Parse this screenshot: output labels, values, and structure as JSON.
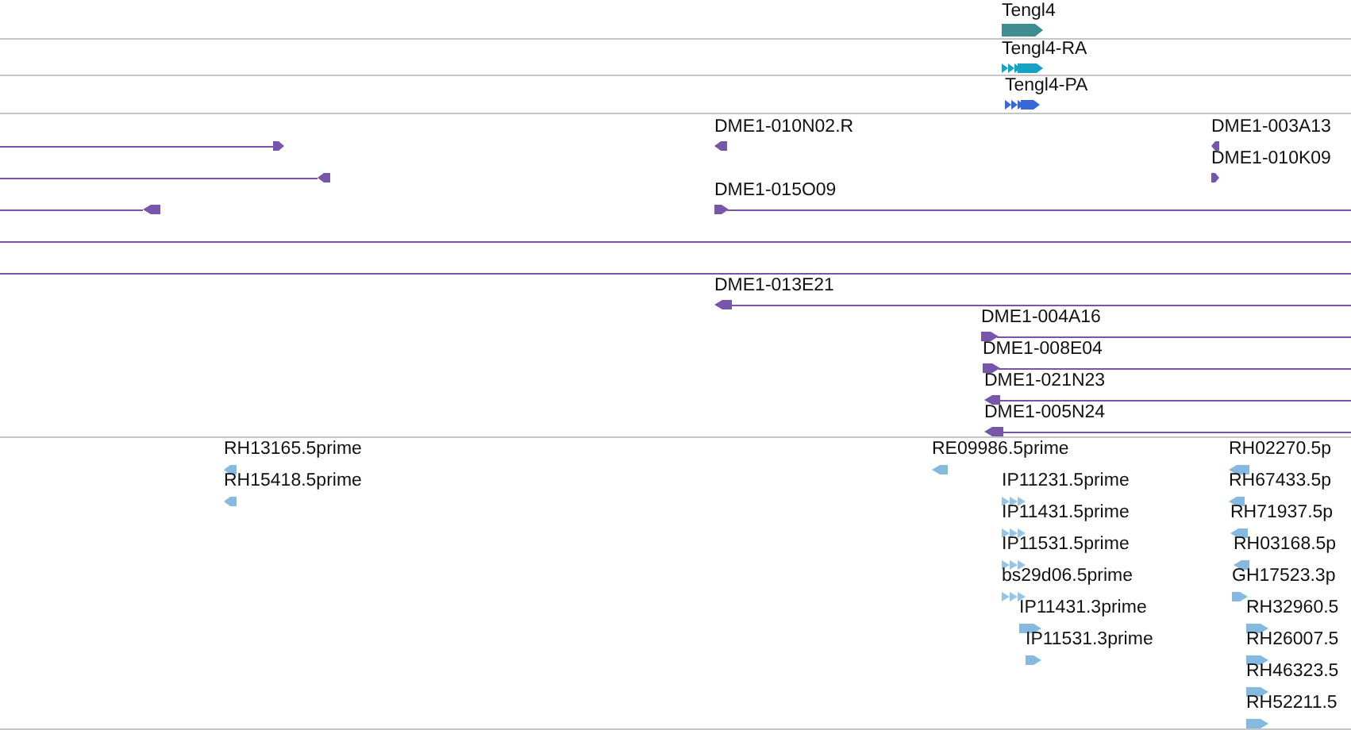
{
  "tracks": [
    {
      "color": "#3f8c91",
      "features": [
        {
          "kind": "gene",
          "label": "Tengl4",
          "reverse": false
        }
      ]
    },
    {
      "color": "#17a2c4",
      "features": [
        {
          "kind": "transcript",
          "label": "Tengl4-RA",
          "reverse": false
        }
      ]
    },
    {
      "color": "#3768d6",
      "features": [
        {
          "kind": "transcript",
          "label": "Tengl4-PA",
          "reverse": false
        }
      ]
    },
    {
      "color": "#7556aa",
      "features": [
        {
          "kind": "clone",
          "reverse": false
        },
        {
          "kind": "clone",
          "label": "DME1-010N02.R",
          "reverse": true
        },
        {
          "kind": "clone",
          "label": "DME1-003A13",
          "reverse": true
        },
        {
          "kind": "clone",
          "reverse": true
        },
        {
          "kind": "clone",
          "label": "DME1-010K09",
          "reverse": false
        },
        {
          "kind": "clone",
          "reverse": true
        },
        {
          "kind": "clone",
          "label": "DME1-015O09",
          "reverse": false
        },
        {
          "kind": "line"
        },
        {
          "kind": "line"
        },
        {
          "kind": "clone",
          "label": "DME1-013E21",
          "reverse": true
        },
        {
          "kind": "clone",
          "label": "DME1-004A16",
          "reverse": false
        },
        {
          "kind": "clone",
          "label": "DME1-008E04",
          "reverse": false
        },
        {
          "kind": "clone",
          "label": "DME1-021N23",
          "reverse": true
        },
        {
          "kind": "clone",
          "label": "DME1-005N24",
          "reverse": true
        }
      ]
    },
    {
      "color": "#86b9df",
      "features": [
        {
          "kind": "est",
          "label": "RH13165.5prime",
          "reverse": true
        },
        {
          "kind": "est",
          "label": "RE09986.5prime",
          "reverse": true
        },
        {
          "kind": "est",
          "label": "RH02270.5p",
          "reverse": true
        },
        {
          "kind": "est",
          "label": "RH15418.5prime",
          "reverse": true
        },
        {
          "kind": "read",
          "label": "IP11231.5prime",
          "reverse": false
        },
        {
          "kind": "est",
          "label": "RH67433.5p",
          "reverse": true
        },
        {
          "kind": "read",
          "label": "IP11431.5prime",
          "reverse": false
        },
        {
          "kind": "est",
          "label": "RH71937.5p",
          "reverse": true
        },
        {
          "kind": "read",
          "label": "IP11531.5prime",
          "reverse": false
        },
        {
          "kind": "est",
          "label": "RH03168.5p",
          "reverse": true
        },
        {
          "kind": "read",
          "label": "bs29d06.5prime",
          "reverse": false
        },
        {
          "kind": "est",
          "label": "GH17523.3p",
          "reverse": false
        },
        {
          "kind": "est",
          "label": "IP11431.3prime",
          "reverse": false
        },
        {
          "kind": "est",
          "label": "RH32960.5",
          "reverse": false
        },
        {
          "kind": "est",
          "label": "IP11531.3prime",
          "reverse": false
        },
        {
          "kind": "est",
          "label": "RH26007.5",
          "reverse": false
        },
        {
          "kind": "est",
          "label": "RH46323.5",
          "reverse": false
        },
        {
          "kind": "est",
          "label": "RH52211.5",
          "reverse": false
        }
      ]
    }
  ]
}
